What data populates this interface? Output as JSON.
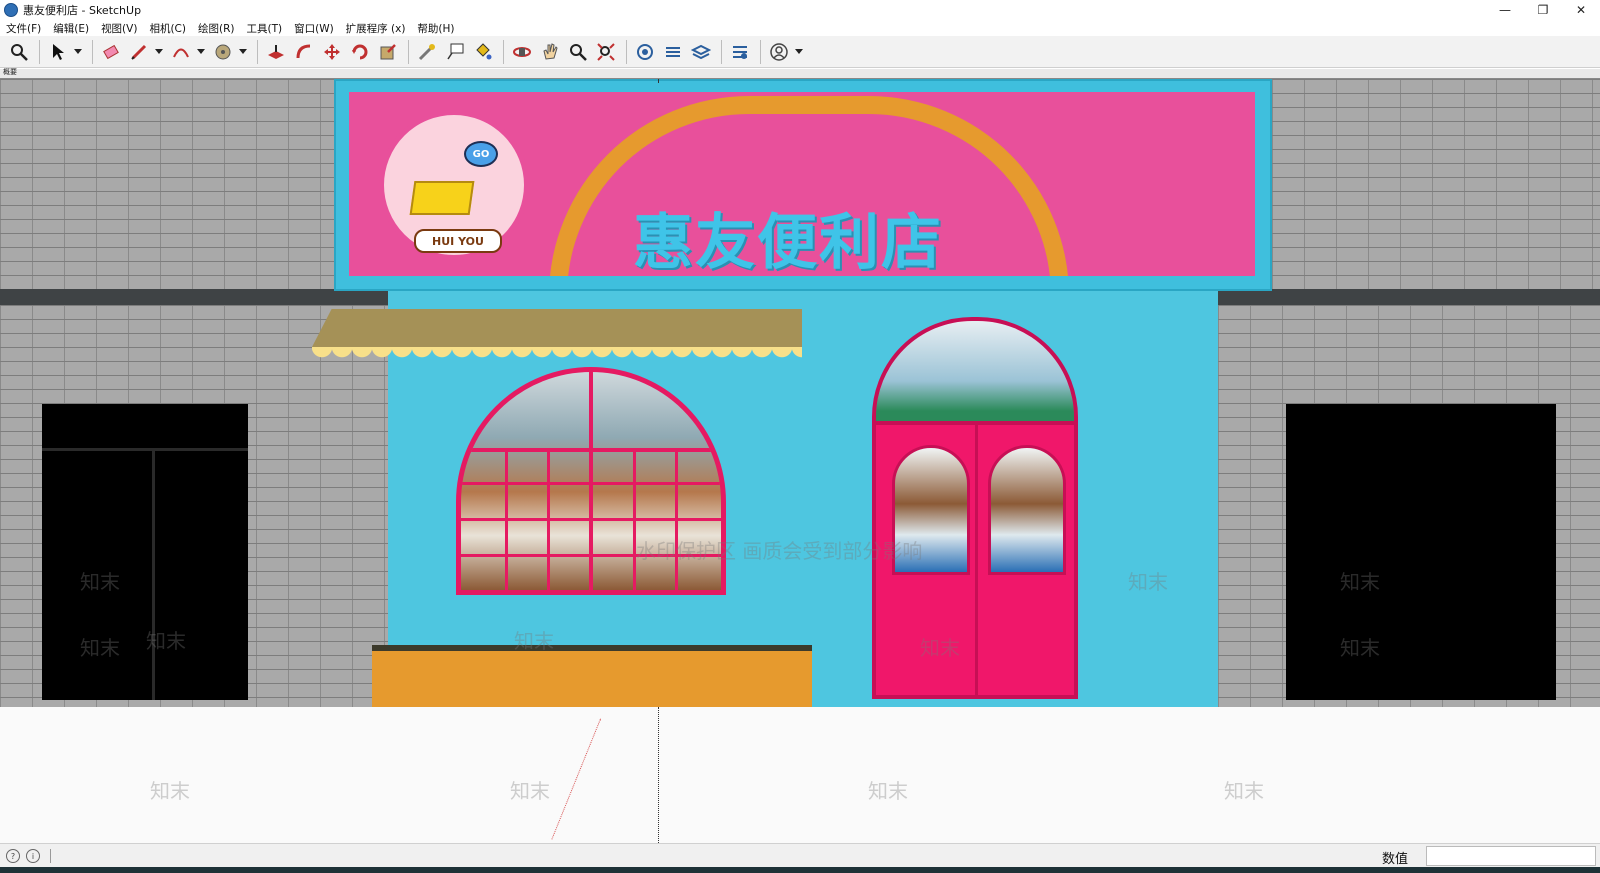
{
  "window": {
    "title": "惠友便利店 - SketchUp",
    "minimize": "—",
    "restore": "❐",
    "close": "✕"
  },
  "menu": [
    "文件(F)",
    "编辑(E)",
    "视图(V)",
    "相机(C)",
    "绘图(R)",
    "工具(T)",
    "窗口(W)",
    "扩展程序 (x)",
    "帮助(H)"
  ],
  "toolbar": {
    "tools": [
      "zoom-tool",
      "select-tool",
      "eraser-tool",
      "pencil-tool",
      "arc-tool",
      "paint-tool",
      "pushpull-tool",
      "followme-tool",
      "move-tool",
      "rotate-tool",
      "scale-tool",
      "tape-tool",
      "text-tool",
      "paint-bucket-tool",
      "orbit-tool",
      "pan-tool",
      "zoom-glass-tool",
      "zoom-extents-tool",
      "warehouse-tool",
      "extension-tool",
      "layers-tool",
      "ext-warehouse-tool",
      "account-tool"
    ]
  },
  "scene": {
    "tab_label": "概要",
    "sign_text": "惠友便利店",
    "logo_label": "HUI YOU",
    "logo_go": "GO",
    "watermark_main": "水印保护区   画质会受到部分影响",
    "watermark_brand": "知末"
  },
  "status": {
    "measurements_label": "数值",
    "measurements_value": ""
  },
  "colors": {
    "sign_pink": "#e8509b",
    "storefront_blue": "#4ec6e0",
    "door_pink": "#f0176a",
    "awning_yellow": "#f8e08a",
    "orange": "#e69a2e"
  }
}
